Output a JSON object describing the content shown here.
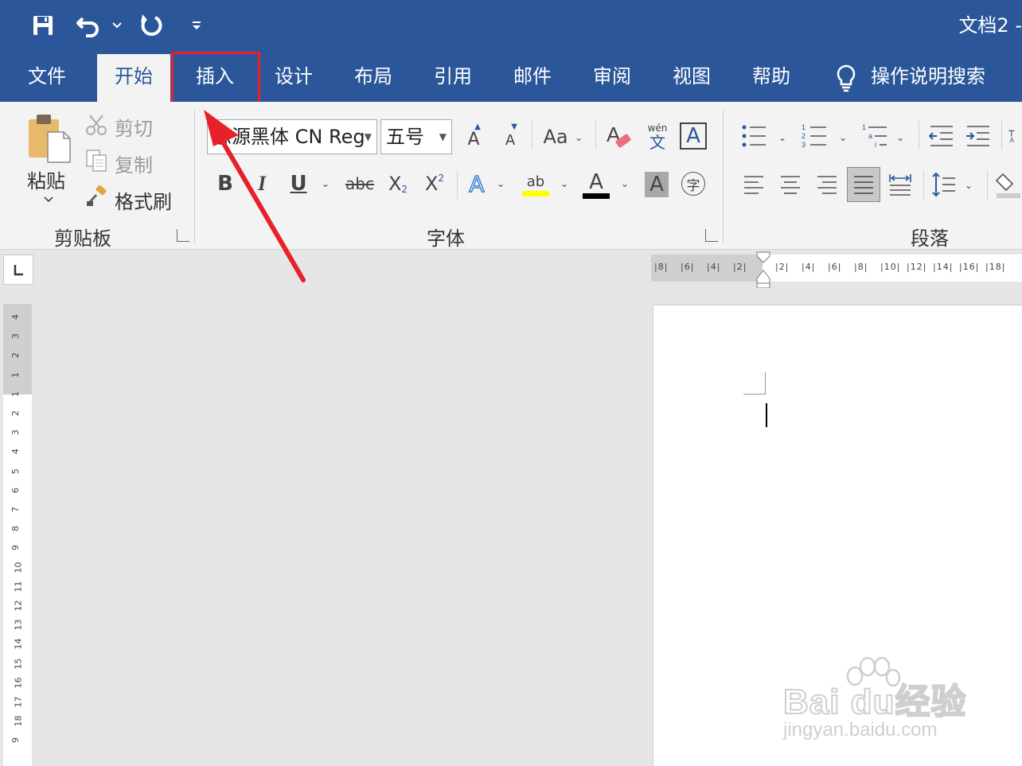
{
  "window": {
    "title": "文档2  -"
  },
  "tabs": [
    {
      "label": "文件"
    },
    {
      "label": "开始",
      "active": true
    },
    {
      "label": "插入",
      "highlighted": true
    },
    {
      "label": "设计"
    },
    {
      "label": "布局"
    },
    {
      "label": "引用"
    },
    {
      "label": "邮件"
    },
    {
      "label": "审阅"
    },
    {
      "label": "视图"
    },
    {
      "label": "帮助"
    }
  ],
  "tell_me": {
    "label": "操作说明搜索",
    "icon": "lightbulb-icon"
  },
  "clipboard": {
    "paste_label": "粘贴",
    "cut_label": "剪切",
    "copy_label": "复制",
    "format_painter_label": "格式刷",
    "group_label": "剪贴板"
  },
  "font": {
    "font_name": "思源黑体 CN Reg",
    "font_size": "五号",
    "change_case_label": "Aa",
    "phonetic_top": "wén",
    "phonetic_bottom": "文",
    "bold": "B",
    "italic": "I",
    "underline": "U",
    "strike": "abc",
    "subscript": "X",
    "subscript_mark": "2",
    "superscript": "X",
    "superscript_mark": "2",
    "text_effect": "A",
    "highlight_text": "ab",
    "font_color_text": "A",
    "shading_text": "A",
    "enclose_text": "字",
    "border_text": "A",
    "grow": "A",
    "shrink": "A",
    "group_label": "字体",
    "highlight_color": "#ffff00",
    "font_color": "#000000"
  },
  "paragraph": {
    "group_label": "段落"
  },
  "rulers": {
    "horizontal_labels": [
      "8",
      "6",
      "4",
      "2",
      "2",
      "4",
      "6",
      "8",
      "10",
      "12",
      "14",
      "16",
      "18"
    ],
    "vertical_labels": [
      "4",
      "3",
      "2",
      "1",
      "1",
      "2",
      "3",
      "4",
      "5",
      "6",
      "7",
      "8",
      "9",
      "10",
      "11",
      "12",
      "13",
      "14",
      "15",
      "16",
      "17",
      "18",
      "9"
    ]
  },
  "watermark": {
    "main": "Bai du经验",
    "sub": "jingyan.baidu.com"
  },
  "colors": {
    "brand": "#2b579a",
    "annotation": "#e8202a"
  }
}
